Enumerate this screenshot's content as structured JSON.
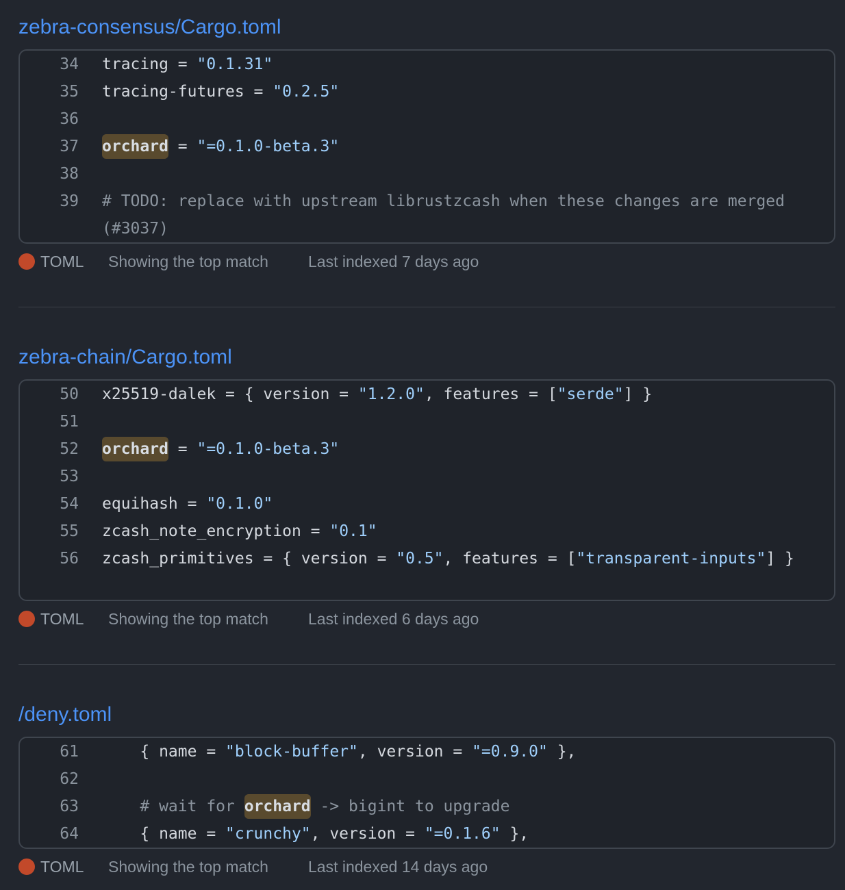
{
  "colors": {
    "background": "#22262e",
    "link": "#4c93f7",
    "string": "#9fcffb",
    "comment": "#8b949e",
    "highlight": "#594a2e",
    "toml_dot": "#c2492a"
  },
  "results": [
    {
      "file": "zebra-consensus/Cargo.toml",
      "language": "TOML",
      "match_note": "Showing the top match",
      "indexed": "Last indexed 7 days ago",
      "lines": [
        {
          "num": "34",
          "segs": [
            {
              "t": "tracing = "
            },
            {
              "t": "\"0.1.31\"",
              "k": "s"
            }
          ]
        },
        {
          "num": "35",
          "segs": [
            {
              "t": "tracing-futures = "
            },
            {
              "t": "\"0.2.5\"",
              "k": "s"
            }
          ]
        },
        {
          "num": "36",
          "segs": []
        },
        {
          "num": "37",
          "segs": [
            {
              "t": "orchard",
              "k": "h"
            },
            {
              "t": " = "
            },
            {
              "t": "\"=0.1.0-beta.3\"",
              "k": "s"
            }
          ]
        },
        {
          "num": "38",
          "segs": []
        },
        {
          "num": "39",
          "wrap": true,
          "segs": [
            {
              "t": "# TODO: replace with upstream librustzcash when these changes are merged (#3037)",
              "k": "c"
            }
          ]
        }
      ]
    },
    {
      "file": "zebra-chain/Cargo.toml",
      "language": "TOML",
      "match_note": "Showing the top match",
      "indexed": "Last indexed 6 days ago",
      "lines": [
        {
          "num": "50",
          "segs": [
            {
              "t": "x25519-dalek = { version = "
            },
            {
              "t": "\"1.2.0\"",
              "k": "s"
            },
            {
              "t": ", features = ["
            },
            {
              "t": "\"serde\"",
              "k": "s"
            },
            {
              "t": "] }"
            }
          ]
        },
        {
          "num": "51",
          "segs": []
        },
        {
          "num": "52",
          "segs": [
            {
              "t": "orchard",
              "k": "h"
            },
            {
              "t": " = "
            },
            {
              "t": "\"=0.1.0-beta.3\"",
              "k": "s"
            }
          ]
        },
        {
          "num": "53",
          "segs": []
        },
        {
          "num": "54",
          "segs": [
            {
              "t": "equihash = "
            },
            {
              "t": "\"0.1.0\"",
              "k": "s"
            }
          ]
        },
        {
          "num": "55",
          "segs": [
            {
              "t": "zcash_note_encryption = "
            },
            {
              "t": "\"0.1\"",
              "k": "s"
            }
          ]
        },
        {
          "num": "56",
          "wrap": true,
          "segs": [
            {
              "t": "zcash_primitives = { version = "
            },
            {
              "t": "\"0.5\"",
              "k": "s"
            },
            {
              "t": ", features = ["
            },
            {
              "t": "\"transparent-inputs\"",
              "k": "s"
            },
            {
              "t": "] }"
            }
          ]
        }
      ]
    },
    {
      "file": "/deny.toml",
      "language": "TOML",
      "match_note": "Showing the top match",
      "indexed": "Last indexed 14 days ago",
      "lines": [
        {
          "num": "61",
          "segs": [
            {
              "t": "    { name = "
            },
            {
              "t": "\"block-buffer\"",
              "k": "s"
            },
            {
              "t": ", version = "
            },
            {
              "t": "\"=0.9.0\"",
              "k": "s"
            },
            {
              "t": " },"
            }
          ]
        },
        {
          "num": "62",
          "segs": []
        },
        {
          "num": "63",
          "segs": [
            {
              "t": "    # wait for ",
              "k": "c"
            },
            {
              "t": "orchard",
              "k": "h"
            },
            {
              "t": " -> bigint to upgrade",
              "k": "c"
            }
          ]
        },
        {
          "num": "64",
          "segs": [
            {
              "t": "    { name = "
            },
            {
              "t": "\"crunchy\"",
              "k": "s"
            },
            {
              "t": ", version = "
            },
            {
              "t": "\"=0.1.6\"",
              "k": "s"
            },
            {
              "t": " },"
            }
          ]
        }
      ]
    }
  ]
}
